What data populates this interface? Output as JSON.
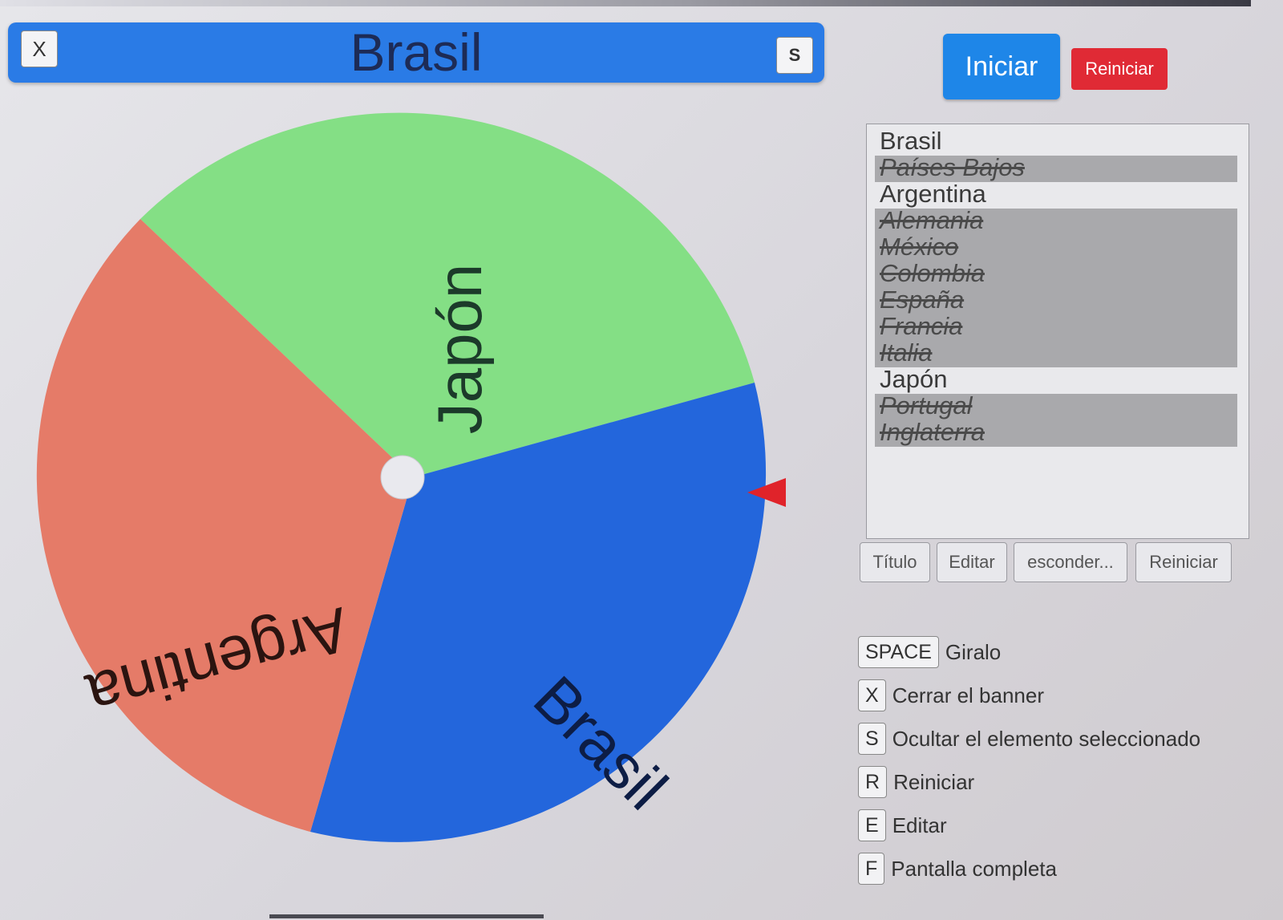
{
  "banner": {
    "title": "Brasil",
    "close_label": "X",
    "hide_label": "S"
  },
  "controls": {
    "start_label": "Iniciar",
    "reset_label": "Reiniciar"
  },
  "wheel": {
    "segments": [
      {
        "label": "Japón",
        "color": "#84df85"
      },
      {
        "label": "Brasil",
        "color": "#2366dc"
      },
      {
        "label": "Argentina",
        "color": "#e57b68"
      }
    ],
    "pointer_color": "#e0232a"
  },
  "entries": [
    {
      "label": "Brasil",
      "hidden": false
    },
    {
      "label": "Países Bajos",
      "hidden": true
    },
    {
      "label": "Argentina",
      "hidden": false
    },
    {
      "label": "Alemania",
      "hidden": true
    },
    {
      "label": "México",
      "hidden": true
    },
    {
      "label": "Colombia",
      "hidden": true
    },
    {
      "label": "España",
      "hidden": true
    },
    {
      "label": "Francia",
      "hidden": true
    },
    {
      "label": "Italia",
      "hidden": true
    },
    {
      "label": "Japón",
      "hidden": false
    },
    {
      "label": "Portugal",
      "hidden": true
    },
    {
      "label": "Inglaterra",
      "hidden": true
    }
  ],
  "list_buttons": {
    "title": "Título",
    "edit": "Editar",
    "hide": "esconder...",
    "reset": "Reiniciar"
  },
  "shortcuts": [
    {
      "key": "SPACE",
      "label": "Giralo"
    },
    {
      "key": "X",
      "label": "Cerrar el banner"
    },
    {
      "key": "S",
      "label": "Ocultar el elemento seleccionado"
    },
    {
      "key": "R",
      "label": "Reiniciar"
    },
    {
      "key": "E",
      "label": "Editar"
    },
    {
      "key": "F",
      "label": "Pantalla completa"
    }
  ]
}
